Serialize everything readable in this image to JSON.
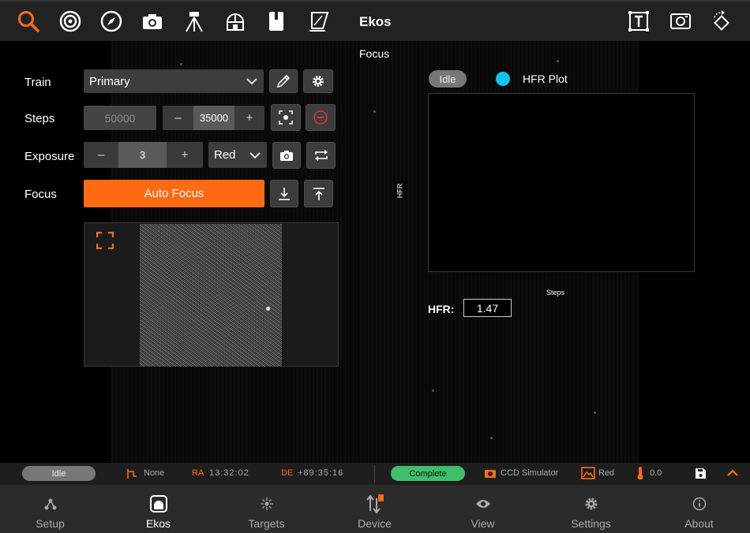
{
  "app": {
    "title": "Ekos"
  },
  "toolbar": {
    "icons": [
      "search-icon",
      "target-icon",
      "compass-icon",
      "camera-icon",
      "tripod-icon",
      "observatory-icon",
      "notebook-icon",
      "flat-panel-icon",
      "text-frame-icon",
      "screenshot-icon",
      "rotate-icon"
    ],
    "accent": "#ff6a12"
  },
  "focus": {
    "section_title": "Focus",
    "train_label": "Train",
    "train_value": "Primary",
    "steps_label": "Steps",
    "steps_placeholder": "50000",
    "steps_value": "35000",
    "exposure_label": "Exposure",
    "exposure_value": "3",
    "filter_value": "Red",
    "focus_label": "Focus",
    "autofocus_label": "Auto Focus",
    "minus": "–",
    "plus": "+"
  },
  "plot": {
    "status": "Idle",
    "legend": "HFR Plot",
    "legend_color": "#11c4f2",
    "ylabel": "HFR",
    "xlabel": "Steps",
    "hfr_label": "HFR:",
    "hfr_value": "1.47"
  },
  "status": {
    "mount_status": "Idle",
    "target": "None",
    "ra_label": "RA",
    "ra_value": "13:32:02",
    "de_label": "DE",
    "de_value": "+89:35:16",
    "capture_status": "Complete",
    "camera": "CCD Simulator",
    "filter": "Red",
    "temperature": "0.0"
  },
  "nav": [
    {
      "label": "Setup",
      "icon": "setup-icon"
    },
    {
      "label": "Ekos",
      "icon": "ekos-icon"
    },
    {
      "label": "Targets",
      "icon": "targets-icon"
    },
    {
      "label": "Device",
      "icon": "device-icon"
    },
    {
      "label": "View",
      "icon": "view-icon"
    },
    {
      "label": "Settings",
      "icon": "settings-icon"
    },
    {
      "label": "About",
      "icon": "about-icon"
    }
  ]
}
